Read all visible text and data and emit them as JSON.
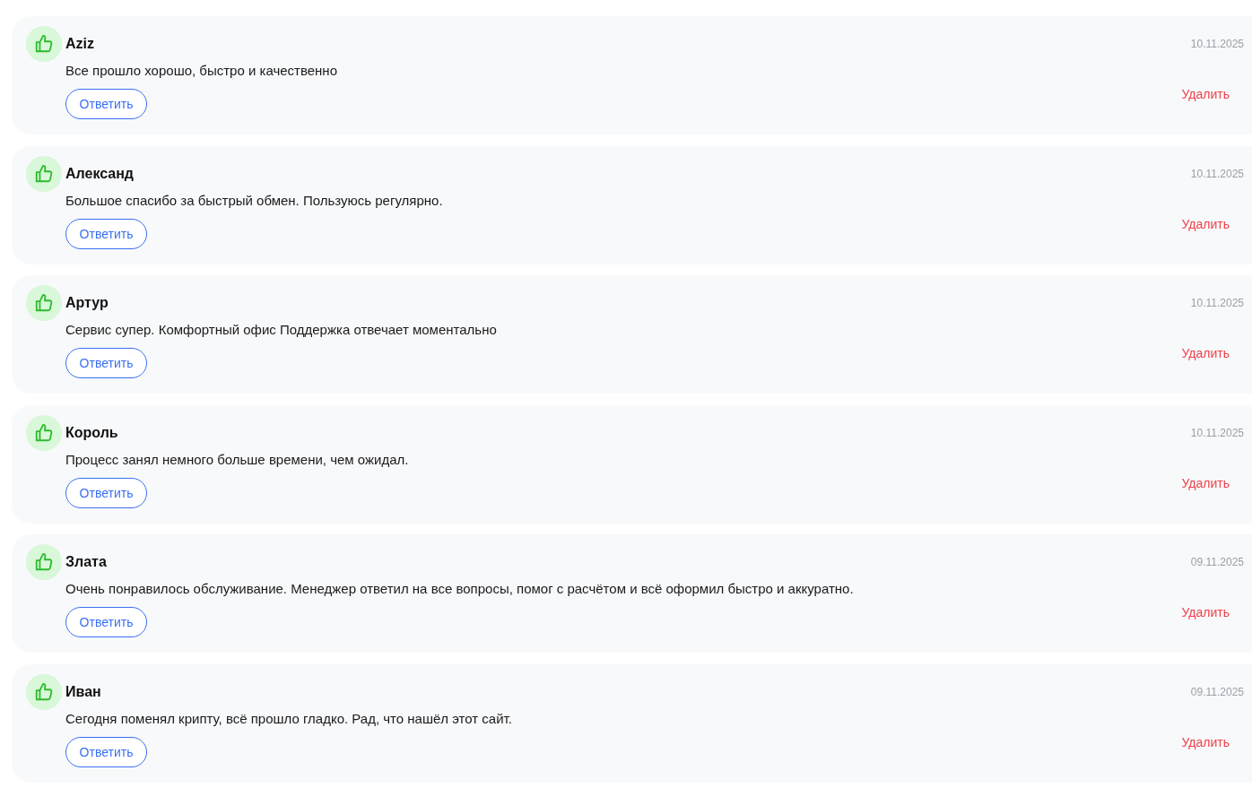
{
  "reviews": [
    {
      "author": "Aziz",
      "date": "10.11.2025",
      "text": "Все прошло хорошо, быстро и качественно",
      "reply_button": "Ответить",
      "delete_link": "Удалить"
    },
    {
      "author": "Александ",
      "date": "10.11.2025",
      "text": "Большое спасибо за быстрый обмен. Пользуюсь регулярно.",
      "reply_button": "Ответить",
      "delete_link": "Удалить"
    },
    {
      "author": "Артур",
      "date": "10.11.2025",
      "text": "Сервис супер. Комфортный офис Поддержка отвечает моментально",
      "reply_button": "Ответить",
      "delete_link": "Удалить"
    },
    {
      "author": "Король",
      "date": "10.11.2025",
      "text": "Процесс занял немного больше времени, чем ожидал.",
      "reply_button": "Ответить",
      "delete_link": "Удалить"
    },
    {
      "author": "Злата",
      "date": "09.11.2025",
      "text": "Очень понравилось обслуживание. Менеджер ответил на все вопросы, помог с расчётом и всё оформил быстро и аккуратно.",
      "reply_button": "Ответить",
      "delete_link": "Удалить"
    },
    {
      "author": "Иван",
      "date": "09.11.2025",
      "text": "Сегодня поменял крипту, всё прошло гладко. Рад, что нашёл этот сайт.",
      "reply_button": "Ответить",
      "delete_link": "Удалить"
    }
  ]
}
